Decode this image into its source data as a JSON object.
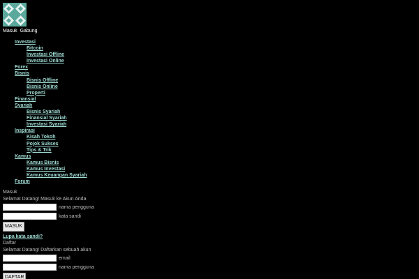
{
  "header": {
    "login_link": "Masuk",
    "register_link": "Gabung"
  },
  "nav": [
    {
      "label": "Investasi",
      "level": 0
    },
    {
      "label": "Bitcoin",
      "level": 1
    },
    {
      "label": "Investasi Offline",
      "level": 1
    },
    {
      "label": "Investasi Online",
      "level": 1
    },
    {
      "label": "Forex",
      "level": 0
    },
    {
      "label": "Bisnis",
      "level": 0
    },
    {
      "label": "Bisnis Offline",
      "level": 1
    },
    {
      "label": "Bisnis Online",
      "level": 1
    },
    {
      "label": "Properti",
      "level": 1
    },
    {
      "label": "Finansial",
      "level": 0
    },
    {
      "label": "Syariah",
      "level": 0
    },
    {
      "label": "Bisnis Syariah",
      "level": 1
    },
    {
      "label": "Finansial Syariah",
      "level": 1
    },
    {
      "label": "Investasi Syariah",
      "level": 1
    },
    {
      "label": "Inspirasi",
      "level": 0
    },
    {
      "label": "Kisah Tokoh",
      "level": 1
    },
    {
      "label": "Pojok Sukses",
      "level": 1
    },
    {
      "label": "Tips & Trik",
      "level": 1
    },
    {
      "label": "Kamus",
      "level": 0
    },
    {
      "label": "Kamus Bisnis",
      "level": 1
    },
    {
      "label": "Kamus Investasi",
      "level": 1
    },
    {
      "label": "Kamus Keuangan Syariah",
      "level": 1
    },
    {
      "label": "Forum",
      "level": 0
    }
  ],
  "login": {
    "title": "Masuk",
    "subtitle": "Selamat Datang! Masuk ke Akun Anda",
    "username_hint": "nama pengguna",
    "password_hint": "kata sandi",
    "submit_label": "MASUK",
    "forgot_label": "Lupa kata sandi?"
  },
  "register": {
    "title": "Daftar",
    "subtitle": "Selamat Datang! Daftarkan sebuah akun",
    "email_hint": "email",
    "username_hint": "nama pengguna",
    "submit_label": "DAFTAR"
  },
  "colors": {
    "background": "#000000",
    "link": "#9fdcd4",
    "logo_teal": "#5aa99c"
  },
  "icons": {
    "logo": "diamond-pattern-logo"
  }
}
